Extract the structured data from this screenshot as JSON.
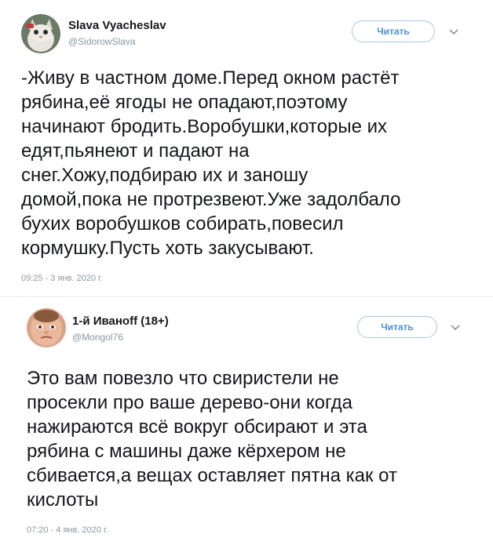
{
  "tweets": [
    {
      "author_name": "Slava Vyacheslav",
      "author_handle": "@SidorowSlava",
      "follow_label": "Читать",
      "text": "-Живу в частном доме.Перед окном растёт\nрябина,её ягоды не опадают,поэтому\nначинают бродить.Воробушки,которые их\nедят,пьянеют и падают на\nснег.Хожу,подбираю их и заношу\nдомой,пока не протрезвеют.Уже задолбало\nбухих воробушков собирать,повесил\nкормушку.Пусть хоть закусывают.",
      "timestamp": "09:25 - 3 янв. 2020 г."
    },
    {
      "author_name": "1-й Иванoff (18+)",
      "author_handle": "@Mongol76",
      "follow_label": "Читать",
      "text": "Это вам повезло что свиристели не\nпросекли про ваше дерево-они когда\nнажираются всё вокруг обсирают и эта\nрябина с машины даже кёрхером не\nсбивается,а вещах оставляет пятна как от\nкислоты",
      "timestamp": "07:20 - 4 янв. 2020 г."
    }
  ],
  "icons": {
    "menu_icon": "chevron-down-icon"
  },
  "colors": {
    "follow_text": "#4a90d6",
    "follow_border": "#a9c7e3",
    "muted": "#8a96a3"
  }
}
